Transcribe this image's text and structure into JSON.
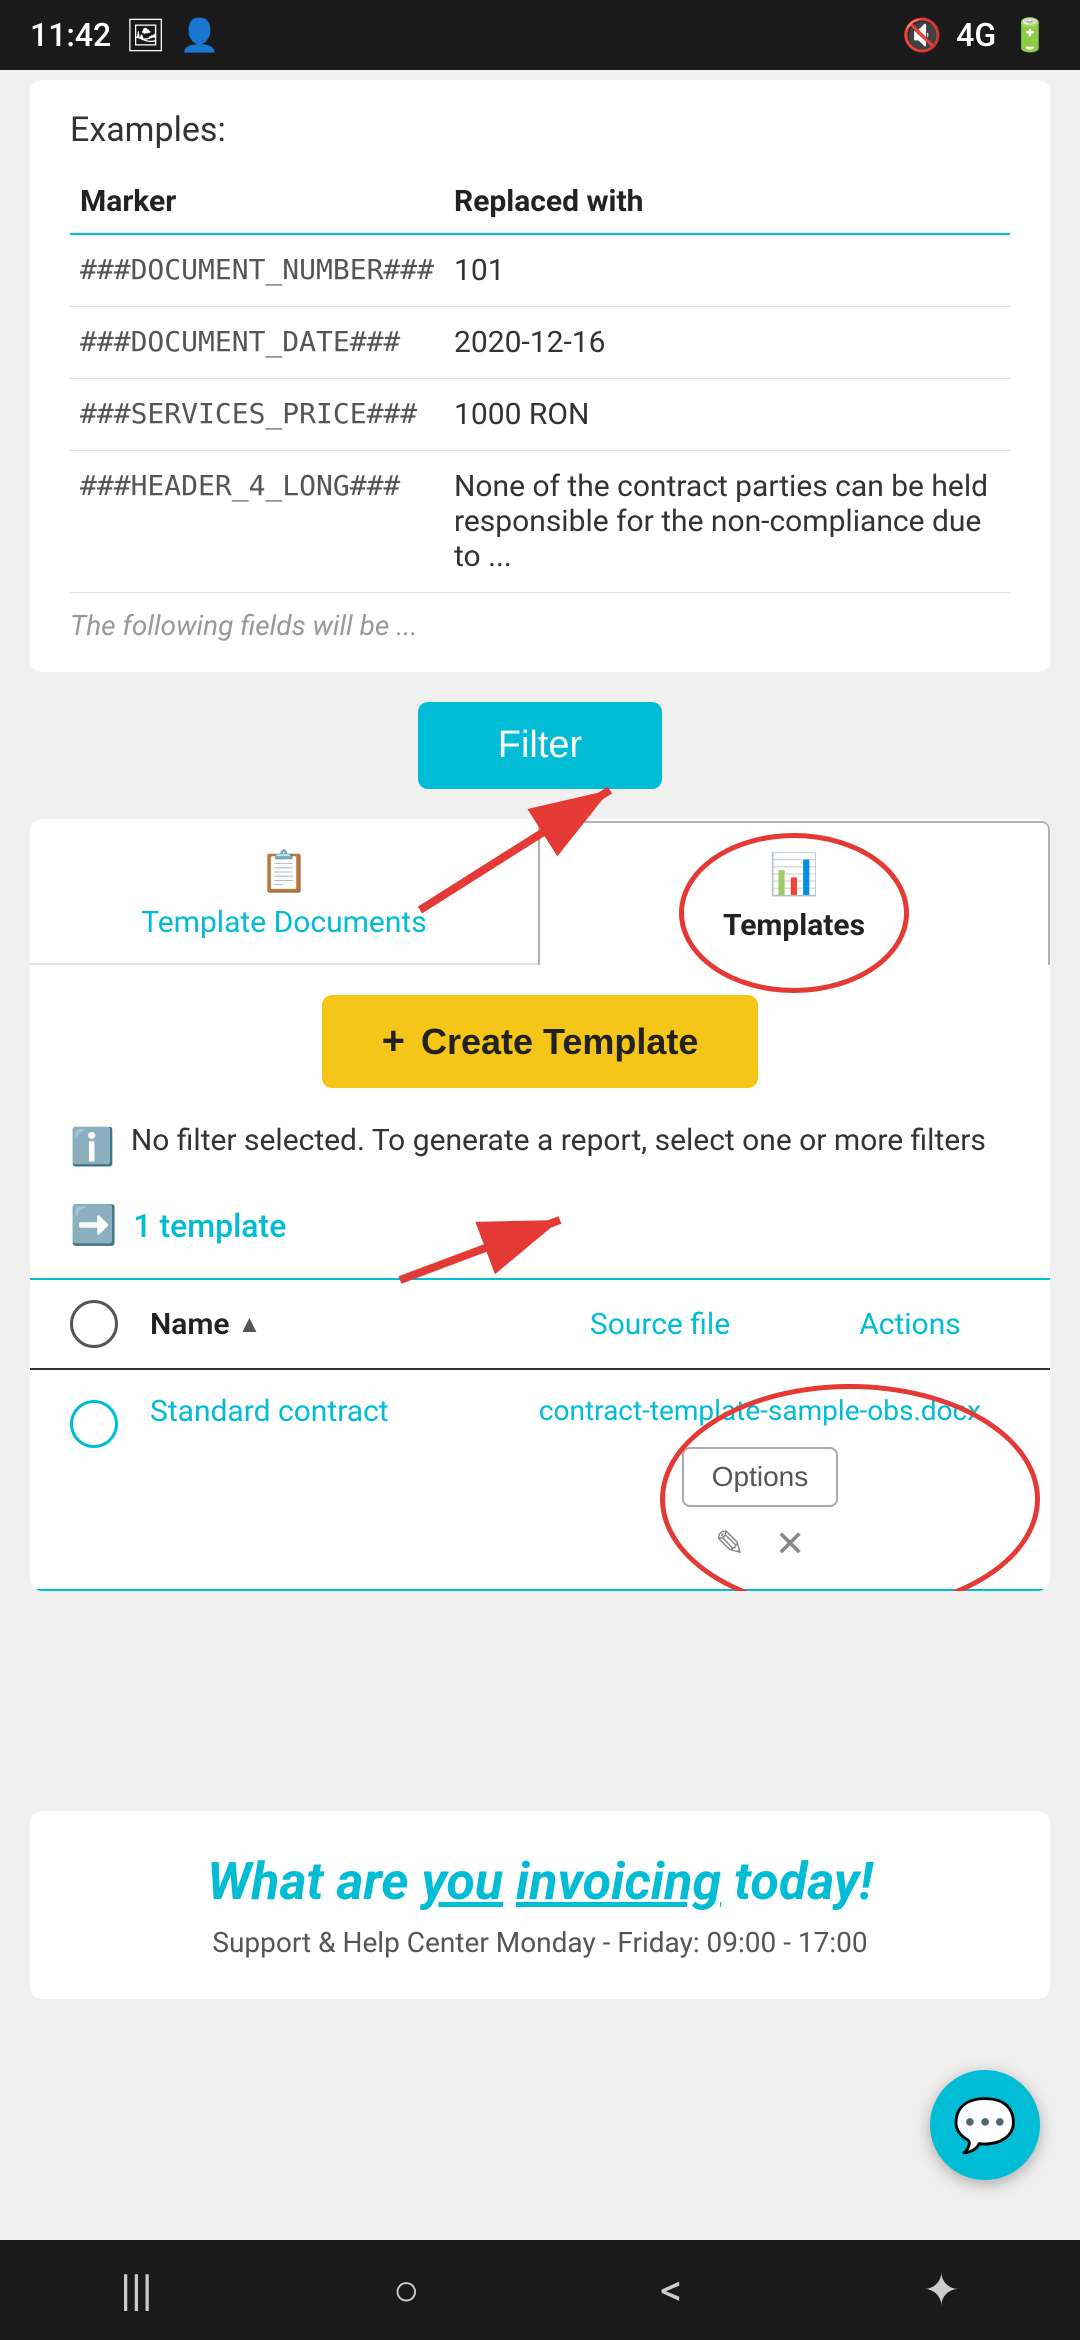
{
  "statusBar": {
    "time": "11:42",
    "icons": [
      "photo",
      "person",
      "mute",
      "4g",
      "signal",
      "battery"
    ]
  },
  "topCard": {
    "examplesLabel": "Examples:",
    "tableHeaders": [
      "Marker",
      "Replaced with"
    ],
    "tableRows": [
      {
        "marker": "###DOCUMENT_NUMBER###",
        "value": "101"
      },
      {
        "marker": "###DOCUMENT_DATE###",
        "value": "2020-12-16"
      },
      {
        "marker": "###SERVICES_PRICE###",
        "value": "1000 RON"
      },
      {
        "marker": "###HEADER_4_LONG###",
        "value": "None of the contract parties can be held responsible for the non-compliance due to ..."
      }
    ],
    "fadeText": "The following fields will be ..."
  },
  "filterButton": {
    "label": "Filter"
  },
  "tabs": [
    {
      "id": "template-documents",
      "label": "Template Documents",
      "active": false
    },
    {
      "id": "templates",
      "label": "Templates",
      "active": true
    }
  ],
  "createButton": {
    "plus": "+",
    "label": "Create Template"
  },
  "infoBanner": {
    "icon": "ℹ",
    "text": "No filter selected. To generate a report, select one or more filters"
  },
  "templateCount": {
    "icon": "➡",
    "text": "1 template"
  },
  "listHeader": {
    "checkboxCol": "",
    "nameCol": "Name",
    "sortIcon": "▲",
    "sourceCol": "Source file",
    "actionsCol": "Actions"
  },
  "listRow": {
    "name": "Standard contract",
    "sourceFile": "contract-template-sample-obs.docx",
    "optionsLabel": "Options",
    "editIcon": "✎",
    "deleteIcon": "✕"
  },
  "footerBanner": {
    "tagline": "What are you invoicing today!",
    "support": "Support & Help Center",
    "hours": "Monday - Friday: 09:00 - 17:00"
  },
  "chatFab": {
    "icon": "💬"
  },
  "navBar": {
    "icons": [
      "|||",
      "○",
      "<",
      "✦"
    ]
  }
}
